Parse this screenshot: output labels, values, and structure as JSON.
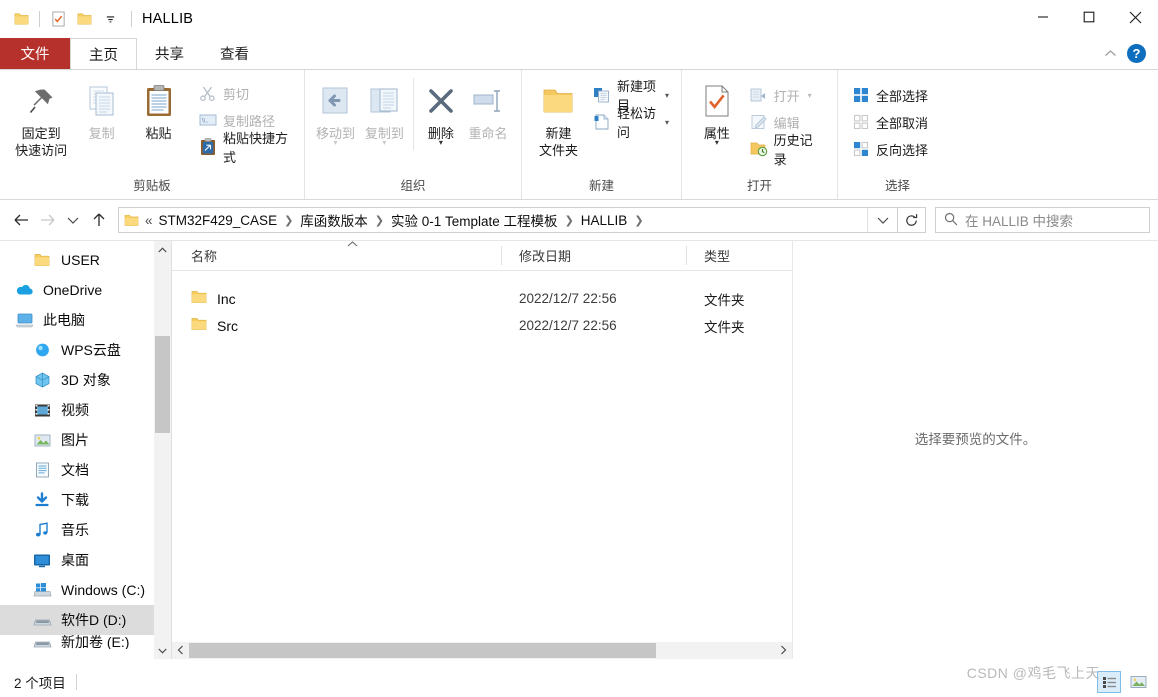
{
  "window": {
    "title": "HALLIB",
    "quick_access": [
      "folder-icon",
      "properties-icon",
      "new-folder-icon",
      "customize-dropdown"
    ],
    "controls": {
      "minimize": "minimize-icon",
      "maximize": "maximize-icon",
      "close": "close-icon"
    }
  },
  "tabs": {
    "file": "文件",
    "items": [
      {
        "label": "主页",
        "active": true
      },
      {
        "label": "共享",
        "active": false
      },
      {
        "label": "查看",
        "active": false
      }
    ],
    "collapse_ribbon": "chevron-up-icon",
    "help": "?"
  },
  "ribbon": {
    "groups": [
      {
        "title": "剪贴板",
        "big": [
          {
            "label": "固定到\n快速访问",
            "label_line1": "固定到",
            "label_line2": "快速访问",
            "icon": "pin-icon",
            "dim": false
          },
          {
            "label": "复制",
            "icon": "copy-icon",
            "dim": true
          },
          {
            "label": "粘贴",
            "icon": "paste-icon",
            "dim": false
          }
        ],
        "small": [
          {
            "label": "剪切",
            "icon": "scissors-icon",
            "dim": true
          },
          {
            "label": "复制路径",
            "icon": "copy-path-icon",
            "dim": true
          },
          {
            "label": "粘贴快捷方式",
            "icon": "paste-shortcut-icon",
            "dim": false
          }
        ]
      },
      {
        "title": "组织",
        "big": [
          {
            "label": "移动到",
            "icon": "move-to-icon",
            "dim": true,
            "dropdown": true
          },
          {
            "label": "复制到",
            "icon": "copy-to-icon",
            "dim": true,
            "dropdown": true
          },
          {
            "label": "删除",
            "icon": "delete-icon",
            "dim": false,
            "dropdown": true
          },
          {
            "label": "重命名",
            "icon": "rename-icon",
            "dim": true
          }
        ]
      },
      {
        "title": "新建",
        "big": [
          {
            "label_line1": "新建",
            "label_line2": "文件夹",
            "icon": "new-folder-icon",
            "dim": false
          }
        ],
        "small": [
          {
            "label": "新建项目",
            "icon": "new-item-icon",
            "dim": false,
            "dropdown": true
          },
          {
            "label": "轻松访问",
            "icon": "easy-access-icon",
            "dim": false,
            "dropdown": true
          }
        ]
      },
      {
        "title": "打开",
        "big": [
          {
            "label": "属性",
            "icon": "properties-icon",
            "dim": false,
            "dropdown": true
          }
        ],
        "small": [
          {
            "label": "打开",
            "icon": "open-icon",
            "dim": true,
            "dropdown": true
          },
          {
            "label": "编辑",
            "icon": "edit-icon",
            "dim": true
          },
          {
            "label": "历史记录",
            "icon": "history-icon",
            "dim": false
          }
        ]
      },
      {
        "title": "选择",
        "small": [
          {
            "label": "全部选择",
            "icon": "select-all-icon",
            "dim": false
          },
          {
            "label": "全部取消",
            "icon": "select-none-icon",
            "dim": false
          },
          {
            "label": "反向选择",
            "icon": "invert-selection-icon",
            "dim": false
          }
        ]
      }
    ]
  },
  "address": {
    "back": "back-arrow-icon",
    "forward": "forward-arrow-icon",
    "recent": "chevron-down-icon",
    "up": "up-arrow-icon",
    "folder_icon": "folder-icon",
    "overflow": "«",
    "crumbs": [
      "STM32F429_CASE",
      "库函数版本",
      "实验 0-1 Template 工程模板",
      "HALLIB"
    ],
    "dropdown": "chevron-down-icon",
    "refresh": "refresh-icon",
    "search_placeholder": "在 HALLIB 中搜索",
    "search_icon": "search-icon"
  },
  "navpane": {
    "items": [
      {
        "label": "USER",
        "icon": "folder-icon",
        "indent": 1,
        "selected": false
      },
      {
        "label": "OneDrive",
        "icon": "onedrive-icon",
        "indent": 0,
        "selected": false
      },
      {
        "label": "此电脑",
        "icon": "this-pc-icon",
        "indent": 0,
        "selected": false
      },
      {
        "label": "WPS云盘",
        "icon": "wps-cloud-icon",
        "indent": 1,
        "selected": false
      },
      {
        "label": "3D 对象",
        "icon": "3d-objects-icon",
        "indent": 1,
        "selected": false
      },
      {
        "label": "视频",
        "icon": "videos-icon",
        "indent": 1,
        "selected": false
      },
      {
        "label": "图片",
        "icon": "pictures-icon",
        "indent": 1,
        "selected": false
      },
      {
        "label": "文档",
        "icon": "documents-icon",
        "indent": 1,
        "selected": false
      },
      {
        "label": "下载",
        "icon": "downloads-icon",
        "indent": 1,
        "selected": false
      },
      {
        "label": "音乐",
        "icon": "music-icon",
        "indent": 1,
        "selected": false
      },
      {
        "label": "桌面",
        "icon": "desktop-icon",
        "indent": 1,
        "selected": false
      },
      {
        "label": "Windows (C:)",
        "icon": "windows-drive-icon",
        "indent": 1,
        "selected": false
      },
      {
        "label": "软件D (D:)",
        "icon": "drive-icon",
        "indent": 1,
        "selected": true
      },
      {
        "label": "新加卷 (E:)",
        "icon": "drive-icon",
        "indent": 1,
        "selected": false
      }
    ]
  },
  "filelist": {
    "columns": [
      "名称",
      "修改日期",
      "类型"
    ],
    "sort_column": "名称",
    "sort_direction": "asc",
    "rows": [
      {
        "name": "Inc",
        "date": "2022/12/7 22:56",
        "type": "文件夹",
        "icon": "folder-icon"
      },
      {
        "name": "Src",
        "date": "2022/12/7 22:56",
        "type": "文件夹",
        "icon": "folder-icon"
      }
    ]
  },
  "preview": {
    "message": "选择要预览的文件。"
  },
  "statusbar": {
    "item_count": "2 个项目",
    "view_details": "details-view-icon",
    "view_large": "large-icons-view-icon"
  },
  "watermark": "CSDN @鸡毛飞上天",
  "colors": {
    "file_tab": "#b7312c",
    "help_blue": "#0d6ebe",
    "folder_yellow": "#f7d077",
    "selection_gray": "#dcdcdc",
    "accent_blue": "#0d6ebe"
  }
}
